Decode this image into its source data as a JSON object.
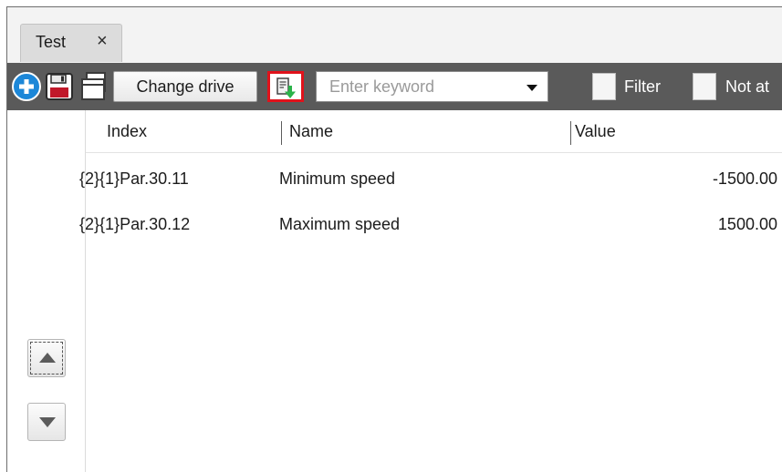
{
  "tab": {
    "label": "Test",
    "close_glyph": "×"
  },
  "toolbar": {
    "change_drive_label": "Change drive",
    "search_placeholder": "Enter keyword",
    "filter_label": "Filter",
    "not_at_label": "Not at",
    "download_button_highlight": "#e0121b"
  },
  "table": {
    "headers": [
      "Index",
      "Name",
      "Value"
    ],
    "rows": [
      {
        "index": "{2}{1}Par.30.11",
        "name": "Minimum speed",
        "value": "-1500.00"
      },
      {
        "index": "{2}{1}Par.30.12",
        "name": "Maximum speed",
        "value": "1500.00"
      }
    ]
  },
  "icons": [
    "add-icon",
    "save-icon",
    "copy-icon",
    "download-to-drive-icon",
    "chevron-down-icon",
    "arrow-up-icon",
    "arrow-down-icon"
  ],
  "colors": {
    "toolbar_bg": "#5a5a5a",
    "add_icon": "#1c87d8",
    "download_icon_green": "#2bb34a"
  }
}
